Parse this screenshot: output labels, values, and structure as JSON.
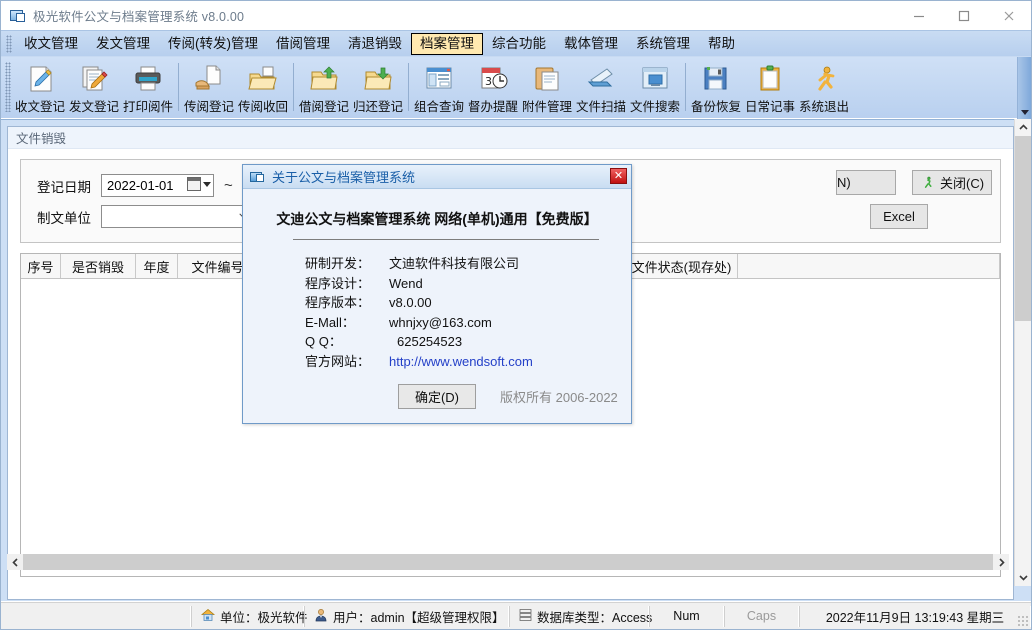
{
  "window": {
    "title": "极光软件公文与档案管理系统 v8.0.00",
    "icon": "app-icon",
    "minimize": "—",
    "maximize": "□",
    "close": "✕"
  },
  "menubar": {
    "items": [
      {
        "label": "收文管理",
        "active": false
      },
      {
        "label": "发文管理",
        "active": false
      },
      {
        "label": "传阅(转发)管理",
        "active": false
      },
      {
        "label": "借阅管理",
        "active": false
      },
      {
        "label": "清退销毁",
        "active": false
      },
      {
        "label": "档案管理",
        "active": true
      },
      {
        "label": "综合功能",
        "active": false
      },
      {
        "label": "载体管理",
        "active": false
      },
      {
        "label": "系统管理",
        "active": false
      },
      {
        "label": "帮助",
        "active": false
      }
    ]
  },
  "toolbar": {
    "groups": [
      {
        "buttons": [
          {
            "label": "收文登记",
            "icon": "pencil-document-icon"
          },
          {
            "label": "发文登记",
            "icon": "pencil-documents-icon"
          },
          {
            "label": "打印阅件",
            "icon": "printer-icon"
          }
        ]
      },
      {
        "buttons": [
          {
            "label": "传阅登记",
            "icon": "hand-document-icon"
          },
          {
            "label": "传阅收回",
            "icon": "folder-open-icon"
          }
        ]
      },
      {
        "buttons": [
          {
            "label": "借阅登记",
            "icon": "folder-up-arrow-icon"
          },
          {
            "label": "归还登记",
            "icon": "folder-down-arrow-icon"
          }
        ]
      },
      {
        "buttons": [
          {
            "label": "组合查询",
            "icon": "window-list-icon"
          },
          {
            "label": "督办提醒",
            "icon": "calendar-clock-icon"
          },
          {
            "label": "附件管理",
            "icon": "clipboard-icon"
          },
          {
            "label": "文件扫描",
            "icon": "scanner-icon"
          },
          {
            "label": "文件搜索",
            "icon": "monitor-search-icon"
          }
        ]
      },
      {
        "buttons": [
          {
            "label": "备份恢复",
            "icon": "floppy-disk-icon"
          },
          {
            "label": "日常记事",
            "icon": "notepad-icon"
          },
          {
            "label": "系统退出",
            "icon": "running-man-icon"
          }
        ]
      }
    ],
    "overflow_icon": "chevron-down-icon"
  },
  "child_window": {
    "title": "文件销毁",
    "filters": {
      "date_label": "登记日期",
      "date_value": "2022-01-01",
      "date_picker_icon": "calendar-icon",
      "range_separator": "~",
      "unit_label": "制文单位",
      "unit_value": "",
      "combo_icon": "chevron-down-icon"
    },
    "buttons": [
      {
        "label": "N)",
        "accel": "N",
        "icon": "",
        "truncated": true
      },
      {
        "label": "关闭(C)",
        "accel": "C",
        "icon": "running-man-icon",
        "truncated": false
      },
      {
        "label": "Excel",
        "accel": "",
        "icon": "",
        "truncated": true
      }
    ],
    "table": {
      "columns": [
        "序号",
        "是否销毁",
        "年度",
        "文件编号",
        "文件状态(现存处)"
      ],
      "rows": []
    }
  },
  "scrollbars": {
    "vertical_up_icon": "chevron-up-icon",
    "vertical_down_icon": "chevron-down-icon",
    "horizontal_left_icon": "chevron-left-icon",
    "horizontal_right_icon": "chevron-right-icon"
  },
  "statusbar": {
    "cells": [
      {
        "icon": "home-icon",
        "text": "单位：极光软件",
        "dim": false
      },
      {
        "icon": "user-icon",
        "text": "用户：admin【超级管理权限】",
        "dim": false
      },
      {
        "icon": "database-icon",
        "text": "数据库类型：Access",
        "dim": false
      },
      {
        "icon": "",
        "text": "Num",
        "dim": false
      },
      {
        "icon": "",
        "text": "Caps",
        "dim": true
      },
      {
        "icon": "",
        "text": "2022年11月9日 13:19:43 星期三",
        "dim": false
      }
    ]
  },
  "dialog": {
    "title": "关于公文与档案管理系统",
    "icon": "app-icon",
    "close_label": "✕",
    "heading": "文迪公文与档案管理系统 网络(单机)通用【免费版】",
    "info": [
      {
        "key": "研制开发：",
        "value": "文迪软件科技有限公司",
        "link": false
      },
      {
        "key": "程序设计：",
        "value": "Wend",
        "link": false
      },
      {
        "key": "程序版本：",
        "value": "v8.0.00",
        "link": false
      },
      {
        "key": "E-Mall：",
        "value": "whnjxy@163.com",
        "link": false
      },
      {
        "key": "Q Q：",
        "value": "625254523",
        "link": false
      },
      {
        "key": "官方网站：",
        "value": "http://www.wendsoft.com",
        "link": true
      }
    ],
    "ok_label": "确定(D)",
    "copyright": "版权所有 2006-2022"
  },
  "colors": {
    "menubar_top": "#c9dcf3",
    "menubar_bottom": "#b7cfee",
    "toolbar_top": "#cfe0f6",
    "toolbar_bottom": "#b9d0ef",
    "mdi_background": "#cddff5",
    "menu_active_bg": "#ffe9b0",
    "dialog_title": "#1a5fa8",
    "dialog_link": "#2440c8",
    "dialog_close_red": "#c01010"
  }
}
